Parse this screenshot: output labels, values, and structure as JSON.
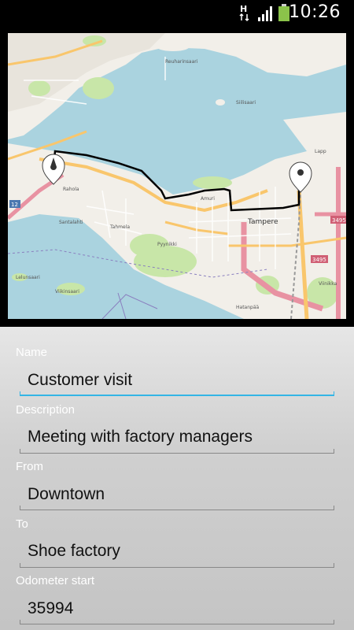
{
  "status_bar": {
    "time": "10:26",
    "network_label": "H",
    "icons": [
      "h-data-icon",
      "signal-icon",
      "battery-icon"
    ],
    "battery_color": "#8bc34a"
  },
  "map": {
    "place_labels": [
      "Tampere",
      "Amuri",
      "Tahmela",
      "Pyynikki",
      "Lapp",
      "Rahola",
      "Hatanpää",
      "Viinikka",
      "Santalahti",
      "Reuharinsaari",
      "Siilisaari",
      "Viikinsaari",
      "Lelunsaari"
    ],
    "road_labels": [
      "3495",
      "12"
    ],
    "markers": [
      "start-marker",
      "end-marker"
    ],
    "colors": {
      "water": "#aad3df",
      "land": "#f2efe9",
      "park": "#c8e6a8",
      "route": "#000000",
      "major_road": "#e892a2",
      "trunk_road": "#f9c66c"
    }
  },
  "form": {
    "fields": [
      {
        "label": "Name",
        "value": "Customer visit"
      },
      {
        "label": "Description",
        "value": "Meeting with factory managers"
      },
      {
        "label": "From",
        "value": "Downtown"
      },
      {
        "label": "To",
        "value": "Shoe factory"
      },
      {
        "label": "Odometer start",
        "value": "35994"
      }
    ],
    "accent": "#33b5e5"
  }
}
